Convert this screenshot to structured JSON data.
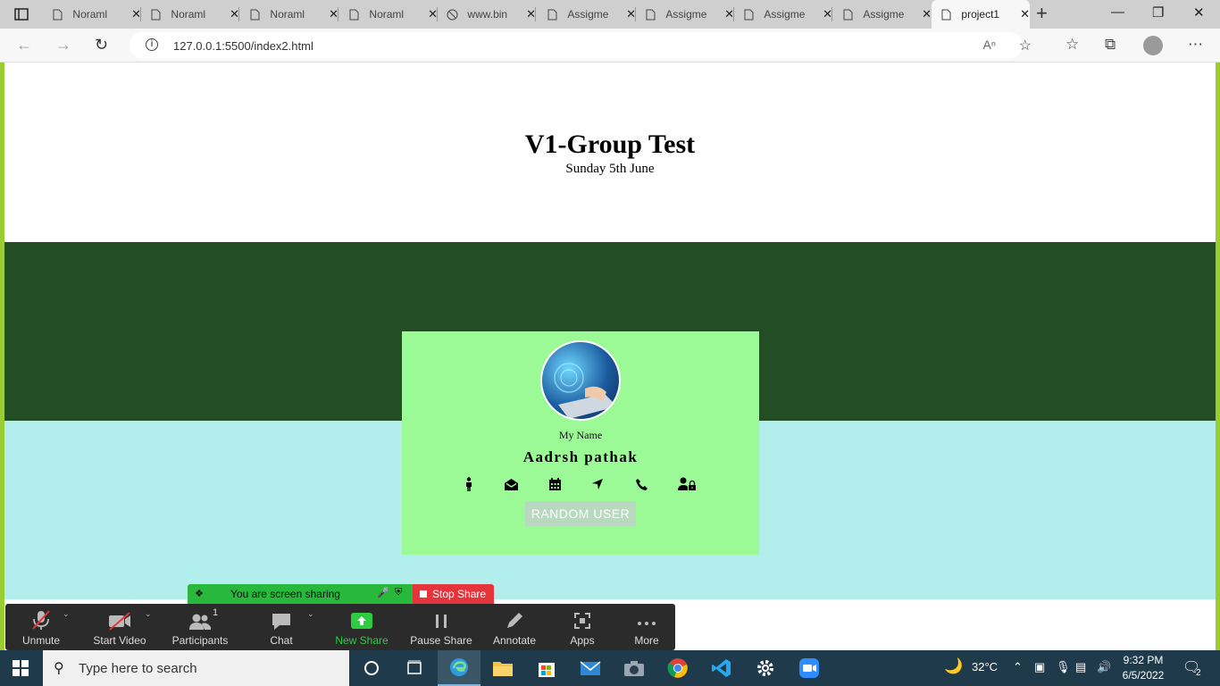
{
  "browser": {
    "tabs": [
      {
        "label": "Noraml",
        "icon": "page-icon"
      },
      {
        "label": "Noraml",
        "icon": "page-icon"
      },
      {
        "label": "Noraml",
        "icon": "page-icon"
      },
      {
        "label": "Noraml",
        "icon": "page-icon"
      },
      {
        "label": "www.bin",
        "icon": "web-icon"
      },
      {
        "label": "Assigme",
        "icon": "page-icon"
      },
      {
        "label": "Assigme",
        "icon": "page-icon"
      },
      {
        "label": "Assigme",
        "icon": "page-icon"
      },
      {
        "label": "Assigme",
        "icon": "page-icon"
      },
      {
        "label": "project1",
        "icon": "page-icon",
        "active": true
      }
    ],
    "url": "127.0.0.1:5500/index2.html",
    "close_glyph": "✕",
    "new_tab_glyph": "+"
  },
  "page": {
    "title": "V1-Group Test",
    "subtitle": "Sunday 5th June",
    "card": {
      "label": "My Name",
      "name": "Aadrsh pathak",
      "button": "RANDOM USER",
      "icons": [
        "person-icon",
        "envelope-icon",
        "calendar-icon",
        "location-arrow-icon",
        "phone-icon",
        "user-lock-icon"
      ]
    },
    "colors": {
      "dark_band": "#224d25",
      "light_band": "#b2eeec",
      "card": "#9bf996",
      "frame": "#9acd32"
    }
  },
  "zoom": {
    "sharing_text": "You are screen sharing",
    "stop_share": "Stop Share",
    "buttons": [
      {
        "label": "Unmute",
        "icon": "muted-mic-icon"
      },
      {
        "label": "Start Video",
        "icon": "video-off-icon"
      },
      {
        "label": "Participants",
        "icon": "participants-icon",
        "count": "1"
      },
      {
        "label": "Chat",
        "icon": "chat-icon"
      },
      {
        "label": "New Share",
        "icon": "share-icon"
      },
      {
        "label": "Pause Share",
        "icon": "pause-icon"
      },
      {
        "label": "Annotate",
        "icon": "pencil-icon"
      },
      {
        "label": "Apps",
        "icon": "apps-icon"
      },
      {
        "label": "More",
        "icon": "more-icon"
      }
    ]
  },
  "taskbar": {
    "search_placeholder": "Type here to search",
    "temperature": "32°C",
    "time": "9:32 PM",
    "date": "6/5/2022",
    "notification_count": "2"
  }
}
